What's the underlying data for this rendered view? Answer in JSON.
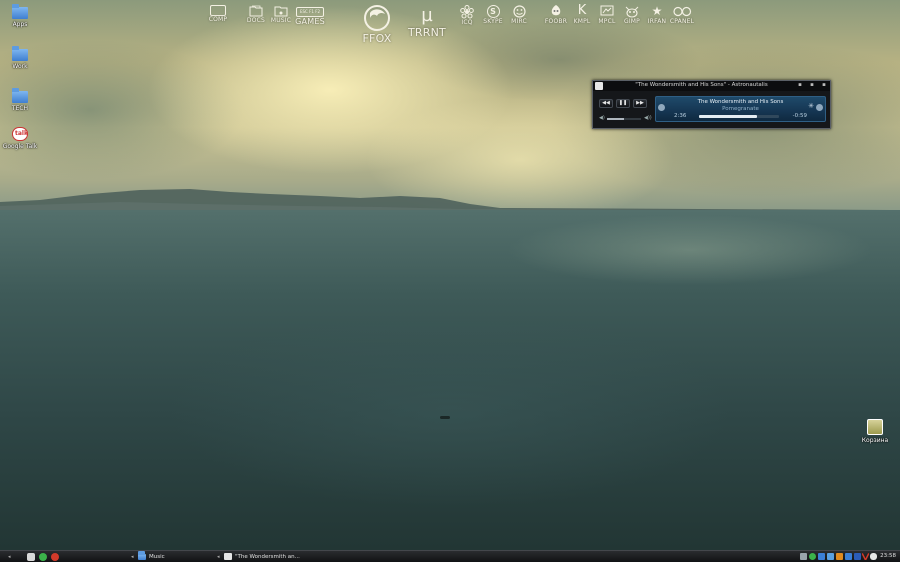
{
  "desktop": {
    "icons": [
      {
        "label": "Apps",
        "icon": "folder-icon"
      },
      {
        "label": "Work",
        "icon": "folder-icon"
      },
      {
        "label": "ТЕСН",
        "icon": "folder-icon"
      },
      {
        "label": "Google Talk",
        "icon": "google-talk-icon",
        "glyph": "talk"
      },
      {
        "label": "Корзина",
        "icon": "trash-icon"
      }
    ]
  },
  "launcher": {
    "items": [
      {
        "label": "COMP",
        "icon": "computer-icon"
      },
      {
        "label": "DOCS",
        "icon": "documents-icon"
      },
      {
        "label": "MUSIC",
        "icon": "music-icon"
      },
      {
        "label": "GAMES",
        "icon": "games-icon",
        "glyph": "ESC F1 F2"
      },
      {
        "label": "FFOX",
        "icon": "firefox-icon"
      },
      {
        "label": "TRRNT",
        "icon": "utorrent-icon",
        "glyph": "µ"
      },
      {
        "label": "ICQ",
        "icon": "icq-icon"
      },
      {
        "label": "SKYPE",
        "icon": "skype-icon",
        "glyph": "S"
      },
      {
        "label": "MIRC",
        "icon": "mirc-icon"
      },
      {
        "label": "FOOBR",
        "icon": "foobar-icon"
      },
      {
        "label": "KMPL",
        "icon": "kmplayer-icon",
        "glyph": "K"
      },
      {
        "label": "MPCL",
        "icon": "mpc-icon"
      },
      {
        "label": "GIMP",
        "icon": "gimp-icon"
      },
      {
        "label": "IRFAN",
        "icon": "irfanview-icon",
        "glyph": "★"
      },
      {
        "label": "CPANEL",
        "icon": "control-panel-icon"
      }
    ]
  },
  "player": {
    "window_title": "\"The Wondersmith and His Sons\" - Astronautalis",
    "artist_line": "The Wondersmith and His Sons",
    "album_line": "Pomegranate",
    "elapsed": "2:36",
    "remaining": "-0:59",
    "progress_fraction": 0.73,
    "volume_fraction": 0.5,
    "buttons": {
      "prev": "◀◀",
      "pause": "❚❚",
      "next": "▶▶"
    },
    "window_buttons": {
      "minimize": "▪",
      "restore": "▪",
      "close": "▪"
    },
    "volume_icon": "◀)",
    "volume_max_icon": "◀))",
    "star": "✳"
  },
  "taskbar": {
    "start_arrow": "◂",
    "tasks": [
      {
        "label": "Music",
        "icon": "folder-icon"
      },
      {
        "label": "\"The Wondersmith an...",
        "icon": "player-icon"
      }
    ],
    "separator_arrow": "◂",
    "clock": "23:58",
    "colors": {
      "green": "#3bb34a",
      "orange": "#e08a1e",
      "red": "#d23a2a",
      "blue": "#3b7fd6"
    }
  }
}
